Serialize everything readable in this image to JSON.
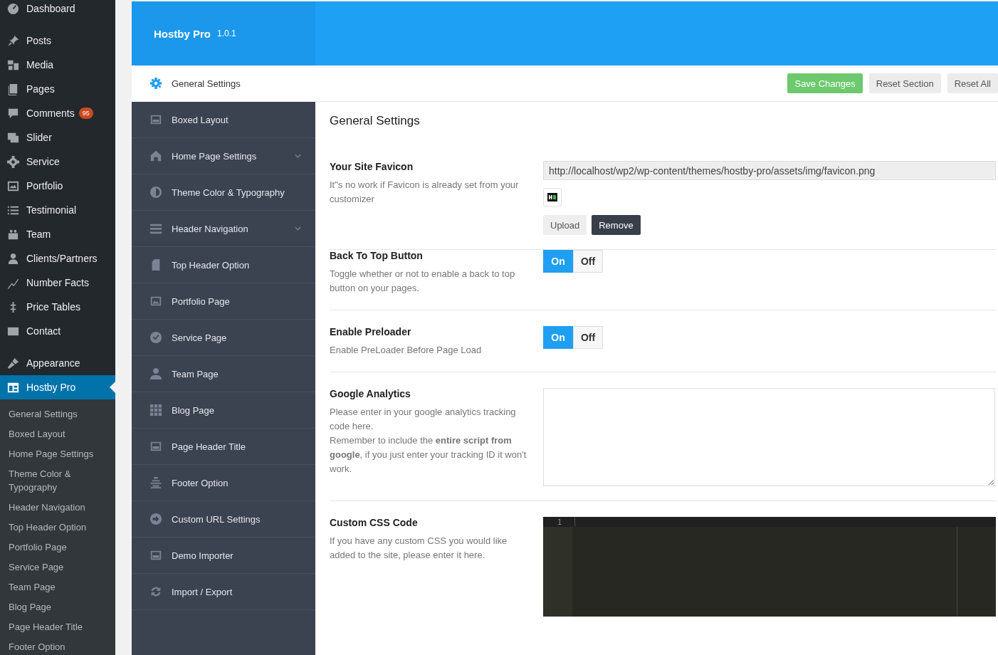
{
  "admin_menu": {
    "items": [
      {
        "label": "Dashboard",
        "selected": false
      },
      {
        "label": "Posts",
        "selected": false
      },
      {
        "label": "Media",
        "selected": false
      },
      {
        "label": "Pages",
        "selected": false
      },
      {
        "label": "Comments",
        "selected": false,
        "badge": "95"
      },
      {
        "label": "Slider",
        "selected": false
      },
      {
        "label": "Service",
        "selected": false
      },
      {
        "label": "Portfolio",
        "selected": false
      },
      {
        "label": "Testimonial",
        "selected": false
      },
      {
        "label": "Team",
        "selected": false
      },
      {
        "label": "Clients/Partners",
        "selected": false
      },
      {
        "label": "Number Facts",
        "selected": false
      },
      {
        "label": "Price Tables",
        "selected": false
      },
      {
        "label": "Contact",
        "selected": false
      },
      {
        "label": "Appearance",
        "selected": false
      },
      {
        "label": "Hostby Pro",
        "selected": true
      }
    ],
    "submenu": [
      "General Settings",
      "Boxed Layout",
      "Home Page Settings",
      "Theme Color & Typography",
      "Header Navigation",
      "Top Header Option",
      "Portfolio Page",
      "Service Page",
      "Team Page",
      "Blog Page",
      "Page Header Title",
      "Footer Option"
    ]
  },
  "header": {
    "title": "Hostby Pro",
    "version": "1.0.1"
  },
  "toolbar": {
    "buttons": [
      {
        "label": "Save Changes",
        "kind": "primary"
      },
      {
        "label": "Reset Section",
        "kind": "default"
      },
      {
        "label": "Reset All",
        "kind": "default"
      }
    ]
  },
  "nav": [
    {
      "label": "General Settings",
      "selected": true,
      "expandable": false
    },
    {
      "label": "Boxed Layout",
      "selected": false,
      "expandable": false
    },
    {
      "label": "Home Page Settings",
      "selected": false,
      "expandable": true
    },
    {
      "label": "Theme Color & Typography",
      "selected": false,
      "expandable": false
    },
    {
      "label": "Header Navigation",
      "selected": false,
      "expandable": true
    },
    {
      "label": "Top Header Option",
      "selected": false,
      "expandable": false
    },
    {
      "label": "Portfolio Page",
      "selected": false,
      "expandable": false
    },
    {
      "label": "Service Page",
      "selected": false,
      "expandable": false
    },
    {
      "label": "Team Page",
      "selected": false,
      "expandable": false
    },
    {
      "label": "Blog Page",
      "selected": false,
      "expandable": false
    },
    {
      "label": "Page Header Title",
      "selected": false,
      "expandable": false
    },
    {
      "label": "Footer Option",
      "selected": false,
      "expandable": false
    },
    {
      "label": "Custom URL Settings",
      "selected": false,
      "expandable": false
    },
    {
      "label": "Demo Importer",
      "selected": false,
      "expandable": false
    },
    {
      "label": "Import / Export",
      "selected": false,
      "expandable": false
    }
  ],
  "section_title": "General Settings",
  "fields": [
    {
      "kind": "media",
      "label": "Your Site Favicon",
      "description": "It\"s no work if Favicon is already set from your customizer",
      "value": "http://localhost/wp2/wp-content/themes/hostby-pro/assets/img/favicon.png",
      "buttons": [
        "Upload",
        "Remove"
      ]
    },
    {
      "kind": "toggle",
      "label": "Back To Top Button",
      "description": "Toggle whether or not to enable a back to top button on your pages.",
      "options": [
        {
          "label": "On",
          "selected": true
        },
        {
          "label": "Off",
          "selected": false
        }
      ]
    },
    {
      "kind": "toggle",
      "label": "Enable Preloader",
      "description": "Enable PreLoader Before Page Load",
      "options": [
        {
          "label": "On",
          "selected": true
        },
        {
          "label": "Off",
          "selected": false
        }
      ]
    },
    {
      "kind": "textarea",
      "label": "Google Analytics",
      "description": "Please enter in your google analytics tracking code here.\nRemember to include the **entire script from google**, if you just enter your tracking ID it won't work."
    },
    {
      "kind": "code",
      "label": "Custom CSS Code",
      "description": "If you have any custom CSS you would like added to the site, please enter it here.",
      "line_number": "1"
    }
  ]
}
